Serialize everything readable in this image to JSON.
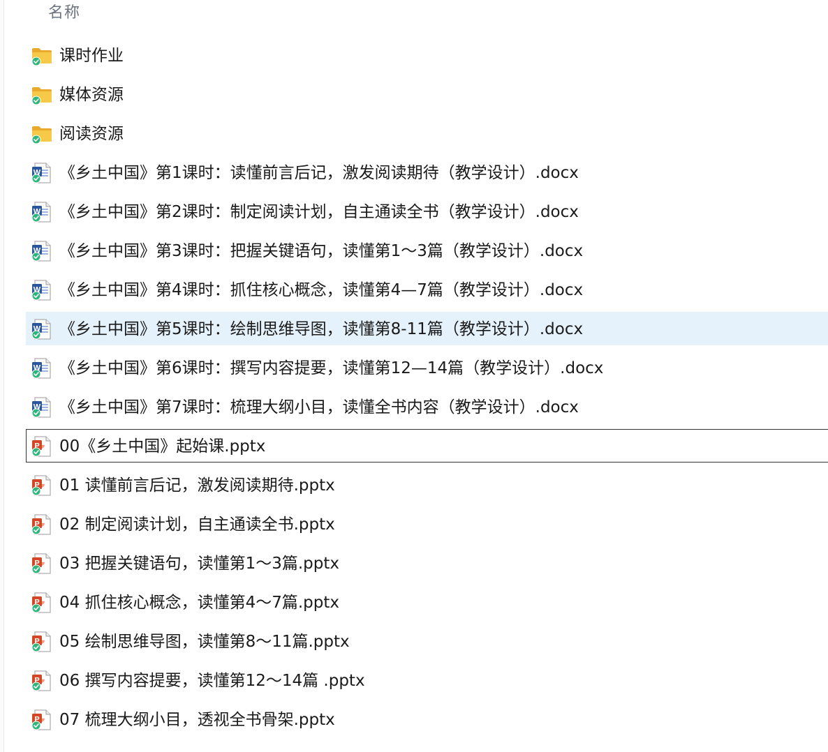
{
  "header": {
    "name_column": "名称"
  },
  "files": [
    {
      "name": "课时作业",
      "type": "folder",
      "synced": true
    },
    {
      "name": "媒体资源",
      "type": "folder",
      "synced": true
    },
    {
      "name": "阅读资源",
      "type": "folder",
      "synced": true
    },
    {
      "name": "《乡土中国》第1课时：读懂前言后记，激发阅读期待（教学设计）.docx",
      "type": "docx",
      "synced": true
    },
    {
      "name": "《乡土中国》第2课时：制定阅读计划，自主通读全书（教学设计）.docx",
      "type": "docx",
      "synced": true
    },
    {
      "name": "《乡土中国》第3课时：把握关键语句，读懂第1～3篇（教学设计）.docx",
      "type": "docx",
      "synced": true
    },
    {
      "name": "《乡土中国》第4课时：抓住核心概念，读懂第4—7篇（教学设计）.docx",
      "type": "docx",
      "synced": true
    },
    {
      "name": "《乡土中国》第5课时：绘制思维导图，读懂第8-11篇（教学设计）.docx",
      "type": "docx",
      "synced": true,
      "state": "selected"
    },
    {
      "name": "《乡土中国》第6课时：撰写内容提要，读懂第12—14篇（教学设计）.docx",
      "type": "docx",
      "synced": true
    },
    {
      "name": "《乡土中国》第7课时：梳理大纲小目，读懂全书内容（教学设计）.docx",
      "type": "docx",
      "synced": true
    },
    {
      "name": "00《乡土中国》起始课.pptx",
      "type": "pptx",
      "synced": true,
      "state": "focused"
    },
    {
      "name": "01 读懂前言后记，激发阅读期待.pptx",
      "type": "pptx",
      "synced": true
    },
    {
      "name": "02 制定阅读计划，自主通读全书.pptx",
      "type": "pptx",
      "synced": true
    },
    {
      "name": "03 把握关键语句，读懂第1～3篇.pptx",
      "type": "pptx",
      "synced": true
    },
    {
      "name": "04 抓住核心概念，读懂第4～7篇.pptx",
      "type": "pptx",
      "synced": true
    },
    {
      "name": "05 绘制思维导图，读懂第8～11篇.pptx",
      "type": "pptx",
      "synced": true
    },
    {
      "name": "06 撰写内容提要，读懂第12～14篇 .pptx",
      "type": "pptx",
      "synced": true
    },
    {
      "name": "07 梳理大纲小目，透视全书骨架.pptx",
      "type": "pptx",
      "synced": true
    }
  ],
  "icons": {
    "folder": "folder-icon",
    "docx": "word-document-icon",
    "pptx": "powerpoint-document-icon",
    "sync": "sync-check-icon"
  },
  "colors": {
    "folder": "#f7c948",
    "word": "#2b579a",
    "powerpoint": "#d24726",
    "sync": "#2fb67c",
    "selection": "#e5f1fb"
  }
}
